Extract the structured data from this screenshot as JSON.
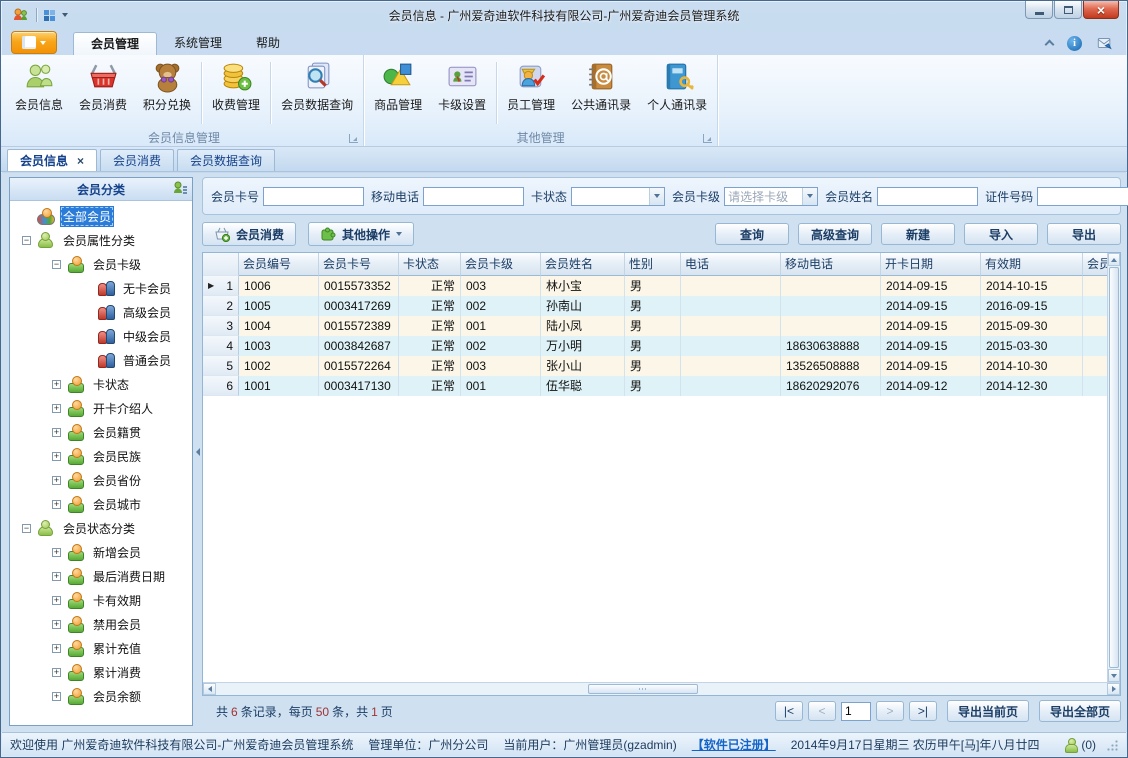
{
  "titlebar": {
    "title": "会员信息 - 广州爱奇迪软件科技有限公司-广州爱奇迪会员管理系统"
  },
  "ribbon": {
    "tabs": [
      {
        "label": "会员管理",
        "active": true
      },
      {
        "label": "系统管理"
      },
      {
        "label": "帮助"
      }
    ],
    "groups": [
      {
        "label": "会员信息管理",
        "buttons": [
          {
            "label": "会员信息",
            "icon": "members-icon"
          },
          {
            "label": "会员消费",
            "icon": "basket-icon"
          },
          {
            "label": "积分兑换",
            "icon": "teddy-icon"
          },
          {
            "label": "收费管理",
            "icon": "coins-plus-icon"
          },
          {
            "label": "会员数据查询",
            "icon": "member-query-icon"
          }
        ]
      },
      {
        "label": "其他管理",
        "buttons": [
          {
            "label": "商品管理",
            "icon": "goods-icon"
          },
          {
            "label": "卡级设置",
            "icon": "card-level-icon"
          },
          {
            "label": "员工管理",
            "icon": "staff-icon"
          },
          {
            "label": "公共通讯录",
            "icon": "public-contacts-icon"
          },
          {
            "label": "个人通讯录",
            "icon": "personal-contacts-icon"
          }
        ]
      }
    ]
  },
  "doc_tabs": [
    {
      "label": "会员信息",
      "active": true,
      "closable": true
    },
    {
      "label": "会员消费"
    },
    {
      "label": "会员数据查询"
    }
  ],
  "tree": {
    "header": "会员分类",
    "items": [
      {
        "label": "全部会员",
        "level": 0,
        "icon": "users-colorful",
        "selected": true
      },
      {
        "label": "会员属性分类",
        "level": 0,
        "expander": "minus",
        "icon": "users-green"
      },
      {
        "label": "会员卡级",
        "level": 1,
        "expander": "minus",
        "icon": "users-orange"
      },
      {
        "label": "无卡会员",
        "level": 2,
        "icon": "users-pair"
      },
      {
        "label": "高级会员",
        "level": 2,
        "icon": "users-pair"
      },
      {
        "label": "中级会员",
        "level": 2,
        "icon": "users-pair"
      },
      {
        "label": "普通会员",
        "level": 2,
        "icon": "users-pair"
      },
      {
        "label": "卡状态",
        "level": 1,
        "expander": "plus",
        "icon": "users-orange"
      },
      {
        "label": "开卡介绍人",
        "level": 1,
        "expander": "plus",
        "icon": "users-orange"
      },
      {
        "label": "会员籍贯",
        "level": 1,
        "expander": "plus",
        "icon": "users-orange"
      },
      {
        "label": "会员民族",
        "level": 1,
        "expander": "plus",
        "icon": "users-orange"
      },
      {
        "label": "会员省份",
        "level": 1,
        "expander": "plus",
        "icon": "users-orange"
      },
      {
        "label": "会员城市",
        "level": 1,
        "expander": "plus",
        "icon": "users-orange"
      },
      {
        "label": "会员状态分类",
        "level": 0,
        "expander": "minus",
        "icon": "users-green"
      },
      {
        "label": "新增会员",
        "level": 1,
        "expander": "plus",
        "icon": "users-orange"
      },
      {
        "label": "最后消费日期",
        "level": 1,
        "expander": "plus",
        "icon": "users-orange"
      },
      {
        "label": "卡有效期",
        "level": 1,
        "expander": "plus",
        "icon": "users-orange"
      },
      {
        "label": "禁用会员",
        "level": 1,
        "expander": "plus",
        "icon": "users-orange"
      },
      {
        "label": "累计充值",
        "level": 1,
        "expander": "plus",
        "icon": "users-orange"
      },
      {
        "label": "累计消费",
        "level": 1,
        "expander": "plus",
        "icon": "users-orange"
      },
      {
        "label": "会员余额",
        "level": 1,
        "expander": "plus",
        "icon": "users-orange"
      }
    ]
  },
  "search": {
    "fields": [
      {
        "label": "会员卡号",
        "is_input": true,
        "value": ""
      },
      {
        "label": "移动电话",
        "is_input": true,
        "value": ""
      },
      {
        "label": "卡状态",
        "is_select": true,
        "value": "",
        "placeholder": ""
      },
      {
        "label": "会员卡级",
        "is_select": true,
        "value": "",
        "placeholder": "请选择卡级"
      },
      {
        "label": "会员姓名",
        "is_input": true,
        "value": ""
      },
      {
        "label": "证件号码",
        "is_input": true,
        "value": ""
      }
    ]
  },
  "toolbar": {
    "consume": "会员消费",
    "more": "其他操作",
    "query": "查询",
    "adv_query": "高级查询",
    "create": "新建",
    "import": "导入",
    "export": "导出"
  },
  "table": {
    "columns": [
      "会员编号",
      "会员卡号",
      "卡状态",
      "会员卡级",
      "会员姓名",
      "性别",
      "电话",
      "移动电话",
      "开卡日期",
      "有效期",
      "会员"
    ],
    "rows": [
      {
        "num": "1",
        "selected": true,
        "member_id": "1006",
        "card_no": "0015573352",
        "status": "正常",
        "level": "003",
        "name": "林小宝",
        "gender": "男",
        "phone": "",
        "mobile": "",
        "open_date": "2014-09-15",
        "expire_date": "2014-10-15"
      },
      {
        "num": "2",
        "member_id": "1005",
        "card_no": "0003417269",
        "status": "正常",
        "level": "002",
        "name": "孙南山",
        "gender": "男",
        "phone": "",
        "mobile": "",
        "open_date": "2014-09-15",
        "expire_date": "2016-09-15"
      },
      {
        "num": "3",
        "member_id": "1004",
        "card_no": "0015572389",
        "status": "正常",
        "level": "001",
        "name": "陆小凤",
        "gender": "男",
        "phone": "",
        "mobile": "",
        "open_date": "2014-09-15",
        "expire_date": "2015-09-30"
      },
      {
        "num": "4",
        "member_id": "1003",
        "card_no": "0003842687",
        "status": "正常",
        "level": "002",
        "name": "万小明",
        "gender": "男",
        "phone": "",
        "mobile": "18630638888",
        "open_date": "2014-09-15",
        "expire_date": "2015-03-30"
      },
      {
        "num": "5",
        "member_id": "1002",
        "card_no": "0015572264",
        "status": "正常",
        "level": "003",
        "name": "张小山",
        "gender": "男",
        "phone": "",
        "mobile": "13526508888",
        "open_date": "2014-09-15",
        "expire_date": "2014-10-30"
      },
      {
        "num": "6",
        "member_id": "1001",
        "card_no": "0003417130",
        "status": "正常",
        "level": "001",
        "name": "伍华聪",
        "gender": "男",
        "phone": "",
        "mobile": "18620292076",
        "open_date": "2014-09-12",
        "expire_date": "2014-12-30"
      }
    ]
  },
  "pagination": {
    "summary_prefix": "共",
    "record_count": "6",
    "summary_mid1": "条记录，每页",
    "page_size": "50",
    "summary_mid2": "条，共",
    "page_count": "1",
    "summary_suffix": "页",
    "first": "|<",
    "prev": "<",
    "page_value": "1",
    "next": ">",
    "last": ">|",
    "export_page": "导出当前页",
    "export_all": "导出全部页"
  },
  "status_bar": {
    "welcome": "欢迎使用 广州爱奇迪软件科技有限公司-广州爱奇迪会员管理系统",
    "org": "管理单位：广州分公司",
    "user": "当前用户：广州管理员(gzadmin)",
    "license": "【软件已注册】",
    "date": "2014年9月17日星期三 农历甲午[马]年八月廿四",
    "online_count": "(0)"
  }
}
